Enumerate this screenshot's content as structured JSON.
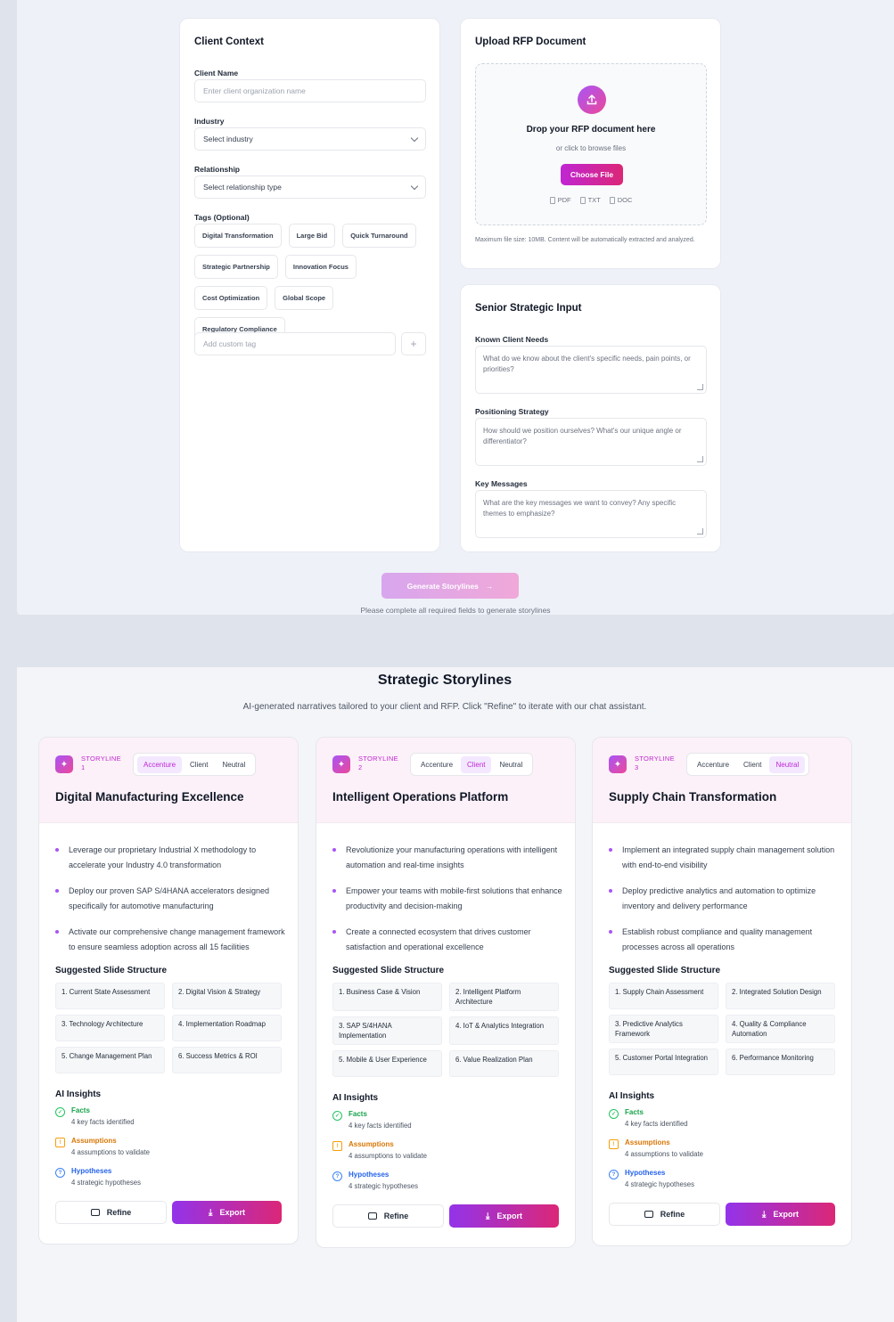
{
  "form": {
    "client_context": {
      "title": "Client Context",
      "client_name_label": "Client Name",
      "client_name_placeholder": "Enter client organization name",
      "industry_label": "Industry",
      "industry_value": "Select industry",
      "relationship_label": "Relationship",
      "relationship_value": "Select relationship type",
      "tags_label": "Tags (Optional)",
      "tags": [
        "Digital Transformation",
        "Large Bid",
        "Quick Turnaround",
        "Strategic Partnership",
        "Innovation Focus",
        "Cost Optimization",
        "Global Scope",
        "Regulatory Compliance"
      ],
      "custom_tag_placeholder": "Add custom tag",
      "add_tag_symbol": "+"
    },
    "upload": {
      "title": "Upload RFP Document",
      "drop_title": "Drop your RFP document here",
      "drop_sub": "or click to browse files",
      "choose_label": "Choose File",
      "formats": [
        "PDF",
        "TXT",
        "DOC"
      ],
      "max_size": "Maximum file size: 10MB. Content will be automatically extracted and analyzed."
    },
    "senior": {
      "title": "Senior Strategic Input",
      "needs_label": "Known Client Needs",
      "needs_placeholder": "What do we know about the client's specific needs, pain points, or priorities?",
      "positioning_label": "Positioning Strategy",
      "positioning_placeholder": "How should we position ourselves? What's our unique angle or differentiator?",
      "messages_label": "Key Messages",
      "messages_placeholder": "What are the key messages we want to convey? Any specific themes to emphasize?"
    },
    "generate_label": "Generate Storylines",
    "generate_arrow": "→",
    "generate_note": "Please complete all required fields to generate storylines"
  },
  "storylines": {
    "title": "Strategic Storylines",
    "subtitle": "AI-generated narratives tailored to your client and RFP. Click \"Refine\" to iterate with our chat assistant.",
    "perspectives": [
      "Accenture",
      "Client",
      "Neutral"
    ],
    "slide_heading": "Suggested Slide Structure",
    "insights_heading": "AI Insights",
    "refine_label": "Refine",
    "export_label": "Export",
    "insight_labels": {
      "facts": "Facts",
      "assumptions": "Assumptions",
      "hypotheses": "Hypotheses"
    },
    "insight_descs": {
      "facts": "4 key facts identified",
      "assumptions": "4 assumptions to validate",
      "hypotheses": "4 strategic hypotheses"
    },
    "cards": [
      {
        "tag_line1": "STORYLINE",
        "tag_line2": "1",
        "active": "Accenture",
        "title": "Digital Manufacturing Excellence",
        "bullets": [
          "Leverage our proprietary Industrial X methodology to accelerate your Industry 4.0 transformation",
          "Deploy our proven SAP S/4HANA accelerators designed specifically for automotive manufacturing",
          "Activate our comprehensive change management framework to ensure seamless adoption across all 15 facilities"
        ],
        "slides": [
          "1. Current State Assessment",
          "2. Digital Vision & Strategy",
          "3. Technology Architecture",
          "4. Implementation Roadmap",
          "5. Change Management Plan",
          "6. Success Metrics & ROI"
        ]
      },
      {
        "tag_line1": "STORYLINE",
        "tag_line2": "2",
        "active": "Client",
        "title": "Intelligent Operations Platform",
        "bullets": [
          "Revolutionize your manufacturing operations with intelligent automation and real-time insights",
          "Empower your teams with mobile-first solutions that enhance productivity and decision-making",
          "Create a connected ecosystem that drives customer satisfaction and operational excellence"
        ],
        "slides": [
          "1. Business Case & Vision",
          "2. Intelligent Platform Architecture",
          "3. SAP S/4HANA Implementation",
          "4. IoT & Analytics Integration",
          "5. Mobile & User Experience",
          "6. Value Realization Plan"
        ]
      },
      {
        "tag_line1": "STORYLINE",
        "tag_line2": "3",
        "active": "Neutral",
        "title": "Supply Chain Transformation",
        "bullets": [
          "Implement an integrated supply chain management solution with end-to-end visibility",
          "Deploy predictive analytics and automation to optimize inventory and delivery performance",
          "Establish robust compliance and quality management processes across all operations"
        ],
        "slides": [
          "1. Supply Chain Assessment",
          "2. Integrated Solution Design",
          "3. Predictive Analytics Framework",
          "4. Quality & Compliance Automation",
          "5. Customer Portal Integration",
          "6. Performance Monitoring"
        ]
      }
    ]
  },
  "colors": {
    "accent_purple": "#a855f7",
    "accent_pink": "#db2777",
    "facts": "#22c55e",
    "assumptions": "#f59e0b",
    "hypotheses": "#3b82f6"
  }
}
